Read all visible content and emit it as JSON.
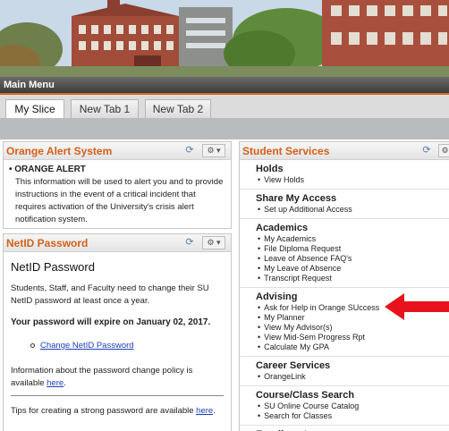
{
  "main_menu": {
    "label": "Main Menu"
  },
  "tabs": [
    {
      "label": "My Slice",
      "active": true
    },
    {
      "label": "New Tab 1",
      "active": false
    },
    {
      "label": "New Tab 2",
      "active": false
    }
  ],
  "orange_alert": {
    "title": "Orange Alert System",
    "item_title": "ORANGE ALERT",
    "text": "This information will be used to alert you and to provide instructions in the event of a critical incident that requires activation of the University's crisis alert notification system."
  },
  "netid": {
    "title": "NetID Password",
    "heading": "NetID Password",
    "para1": "Students, Staff, and Faculty need to change their SU NetID password at least once a year.",
    "expire": "Your password will expire on January 02, 2017.",
    "change_link": "Change NetID Password",
    "policy_text": "Information about the password change policy is available",
    "policy_link": "here",
    "tips_text": "Tips for creating a strong password are available",
    "tips_link": "here"
  },
  "student_services": {
    "title": "Student Services",
    "sections": [
      {
        "heading": "Holds",
        "items": [
          "View Holds"
        ]
      },
      {
        "heading": "Share My Access",
        "items": [
          "Set up Additional Access"
        ]
      },
      {
        "heading": "Academics",
        "items": [
          "My Academics",
          "File Diploma Request",
          "Leave of Absence FAQ's",
          "My Leave of Absence",
          "Transcript Request"
        ]
      },
      {
        "heading": "Advising",
        "items": [
          "Ask for Help in Orange SUccess",
          "My Planner",
          "View My Advisor(s)",
          "View Mid-Sem Progress Rpt",
          "Calculate My GPA"
        ]
      },
      {
        "heading": "Career Services",
        "items": [
          "OrangeLink"
        ]
      },
      {
        "heading": "Course/Class Search",
        "items": [
          "SU Online Course Catalog",
          "Search for Classes"
        ]
      },
      {
        "heading": "Enrollment",
        "items": []
      }
    ]
  },
  "icons": {
    "refresh": "refresh-icon",
    "gear": "gear-icon",
    "arrow": "red-arrow-icon"
  },
  "colors": {
    "accent": "#d4601a",
    "link": "#1a3fb8",
    "arrow": "#e8121c"
  }
}
